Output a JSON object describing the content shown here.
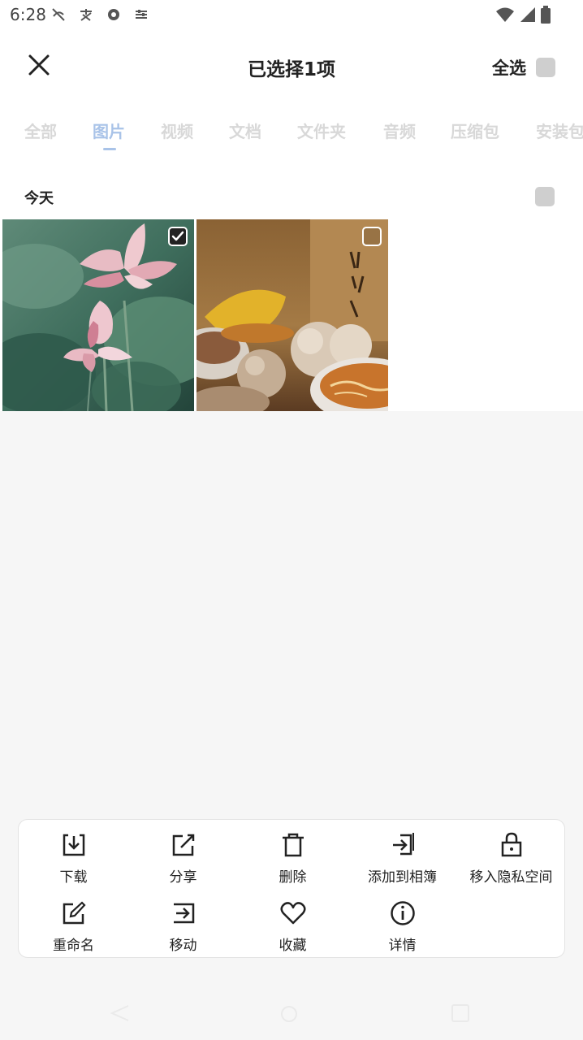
{
  "status_bar": {
    "time": "6:28"
  },
  "header": {
    "title": "已选择1项",
    "select_all_label": "全选"
  },
  "tabs": [
    {
      "label": "全部",
      "active": false
    },
    {
      "label": "图片",
      "active": true
    },
    {
      "label": "视频",
      "active": false
    },
    {
      "label": "文档",
      "active": false
    },
    {
      "label": "文件夹",
      "active": false
    },
    {
      "label": "音频",
      "active": false
    },
    {
      "label": "压缩包",
      "active": false
    },
    {
      "label": "安装包",
      "active": false
    }
  ],
  "section": {
    "title": "今天"
  },
  "photos": [
    {
      "subject": "lotus flowers",
      "selected": true
    },
    {
      "subject": "dumplings and soup",
      "selected": false
    }
  ],
  "actions": [
    {
      "label": "下载",
      "icon": "download-icon"
    },
    {
      "label": "分享",
      "icon": "share-icon"
    },
    {
      "label": "删除",
      "icon": "trash-icon"
    },
    {
      "label": "添加到相簿",
      "icon": "add-to-album-icon"
    },
    {
      "label": "移入隐私空间",
      "icon": "lock-icon"
    },
    {
      "label": "重命名",
      "icon": "rename-icon"
    },
    {
      "label": "移动",
      "icon": "move-icon"
    },
    {
      "label": "收藏",
      "icon": "heart-icon"
    },
    {
      "label": "详情",
      "icon": "info-icon"
    }
  ],
  "colors": {
    "active_tab": "#a9c3e8",
    "inactive_tab": "#d8d8d8",
    "background": "#f6f6f6"
  }
}
